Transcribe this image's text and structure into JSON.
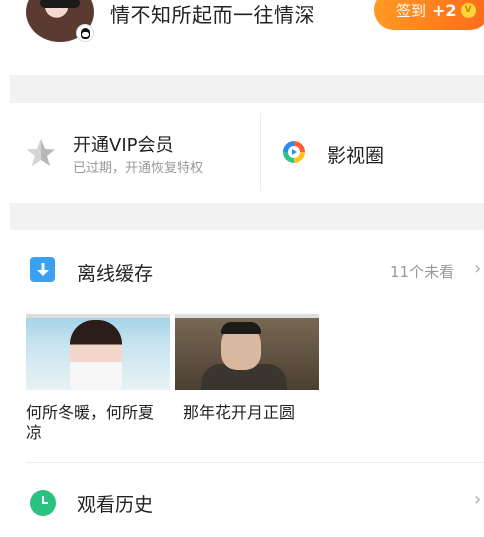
{
  "header": {
    "username": "情不知所起而一往情深",
    "signin_label": "签到",
    "signin_bonus": "+2",
    "coin_symbol": "V"
  },
  "vip": {
    "title": "开通VIP会员",
    "subtitle": "已过期，开通恢复特权"
  },
  "video_circle": {
    "label": "影视圈"
  },
  "offline_cache": {
    "title": "离线缓存",
    "unwatched": "11个未看",
    "videos": [
      {
        "title": "何所冬暖，何所夏凉"
      },
      {
        "title": "那年花开月正圆"
      }
    ]
  },
  "history": {
    "title": "观看历史"
  },
  "chevron_glyph": "›",
  "colors": {
    "accent_orange": "#ff7a1f",
    "download_blue": "#3aa0f0",
    "history_green": "#2bc281",
    "section_gap": "#f2f2f2"
  },
  "icons": [
    "avatar",
    "qq-icon",
    "vcoin-icon",
    "star-icon",
    "video-circle-icon",
    "download-icon",
    "clock-icon",
    "chevron-right-icon"
  ]
}
